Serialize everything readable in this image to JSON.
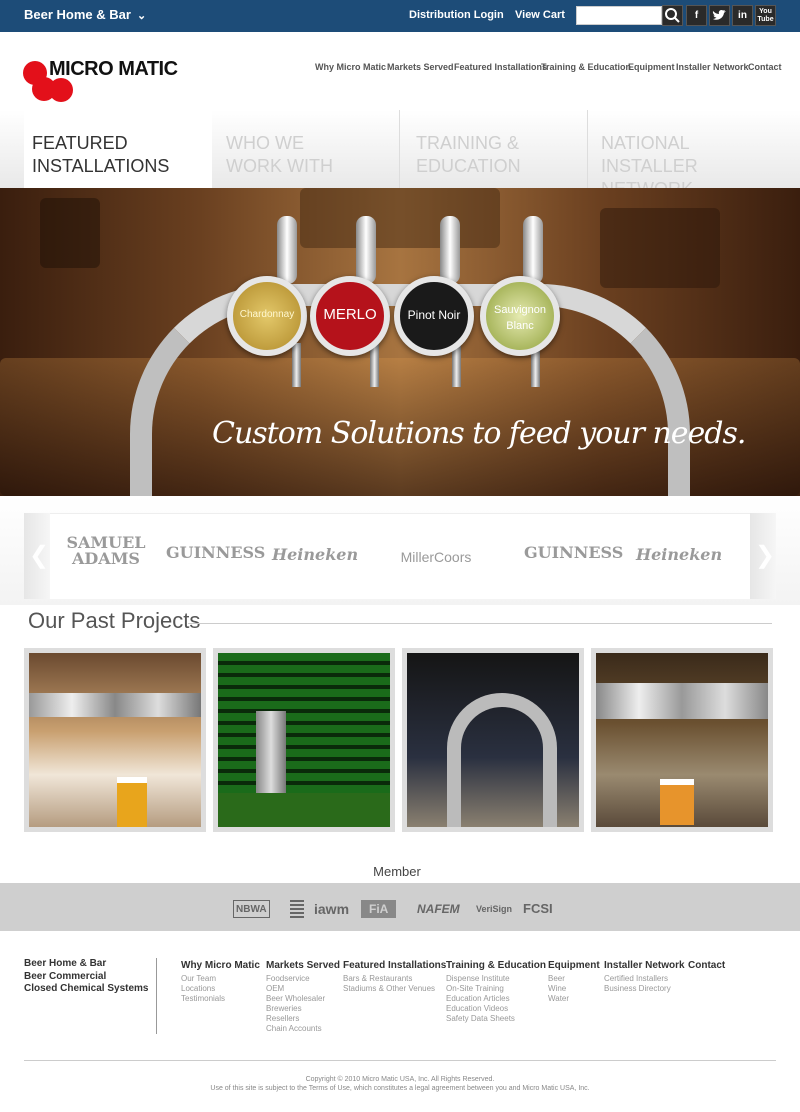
{
  "topbar": {
    "site_select": "Beer Home & Bar",
    "distribution_login": "Distribution Login",
    "view_cart": "View Cart",
    "search_placeholder": "",
    "social": [
      "f",
      "t",
      "in",
      "You Tube"
    ]
  },
  "logo": {
    "text": "MICRO MATIC"
  },
  "nav": [
    "Why Micro Matic",
    "Markets Served",
    "Featured Installations",
    "Training & Education",
    "Equipment",
    "Installer Network",
    "Contact"
  ],
  "tabs": [
    {
      "line1": "FEATURED",
      "line2": "INSTALLATIONS"
    },
    {
      "line1": "WHO WE",
      "line2": "WORK WITH"
    },
    {
      "line1": "TRAINING &",
      "line2": "EDUCATION"
    },
    {
      "line1": "NATIONAL",
      "line2": "INSTALLER NETWORK"
    }
  ],
  "hero": {
    "tap_labels": [
      "Chardonnay",
      "MERLO",
      "Pinot Noir",
      "Sauvignon Blanc"
    ],
    "tagline": "Custom Solutions to feed your needs."
  },
  "brands": [
    "SAMUEL ADAMS",
    "GUINNESS",
    "Heineken",
    "MillerCoors",
    "GUINNESS",
    "Heineken"
  ],
  "projects": {
    "title": "Our Past Projects"
  },
  "member": {
    "title": "Member",
    "logos": [
      "NBWA",
      "",
      "iawm",
      "FiA",
      "NAFEM",
      "VeriSign",
      "FCSI"
    ]
  },
  "footer": {
    "side_links": [
      "Beer Home & Bar",
      "Beer Commercial",
      "Closed Chemical Systems"
    ],
    "columns": [
      {
        "heading": "Why Micro Matic",
        "items": [
          "Our Team",
          "Locations",
          "Testimonials"
        ]
      },
      {
        "heading": "Markets Served",
        "items": [
          "Foodservice",
          "OEM",
          "Beer Wholesaler",
          "Breweries",
          "Resellers",
          "Chain Accounts"
        ]
      },
      {
        "heading": "Featured Installations",
        "items": [
          "Bars & Restaurants",
          "Stadiums & Other Venues"
        ]
      },
      {
        "heading": "Training & Education",
        "items": [
          "Dispense Institute",
          "On-Site Training",
          "Education Articles",
          "Education Videos",
          "Safety Data Sheets"
        ]
      },
      {
        "heading": "Equipment",
        "items": [
          "Beer",
          "Wine",
          "Water"
        ]
      },
      {
        "heading": "Installer Network",
        "items": [
          "Certified Installers",
          "Business Directory"
        ]
      },
      {
        "heading": "Contact",
        "items": []
      }
    ],
    "copyright": "Copyright © 2010 Micro Matic USA, Inc. All Rights Reserved.",
    "terms": "Use of this site is subject to the Terms of Use, which constitutes a legal agreement between you and Micro Matic USA, Inc."
  },
  "colors": {
    "topbar": "#1d4c78",
    "brand_red": "#e3101a"
  }
}
